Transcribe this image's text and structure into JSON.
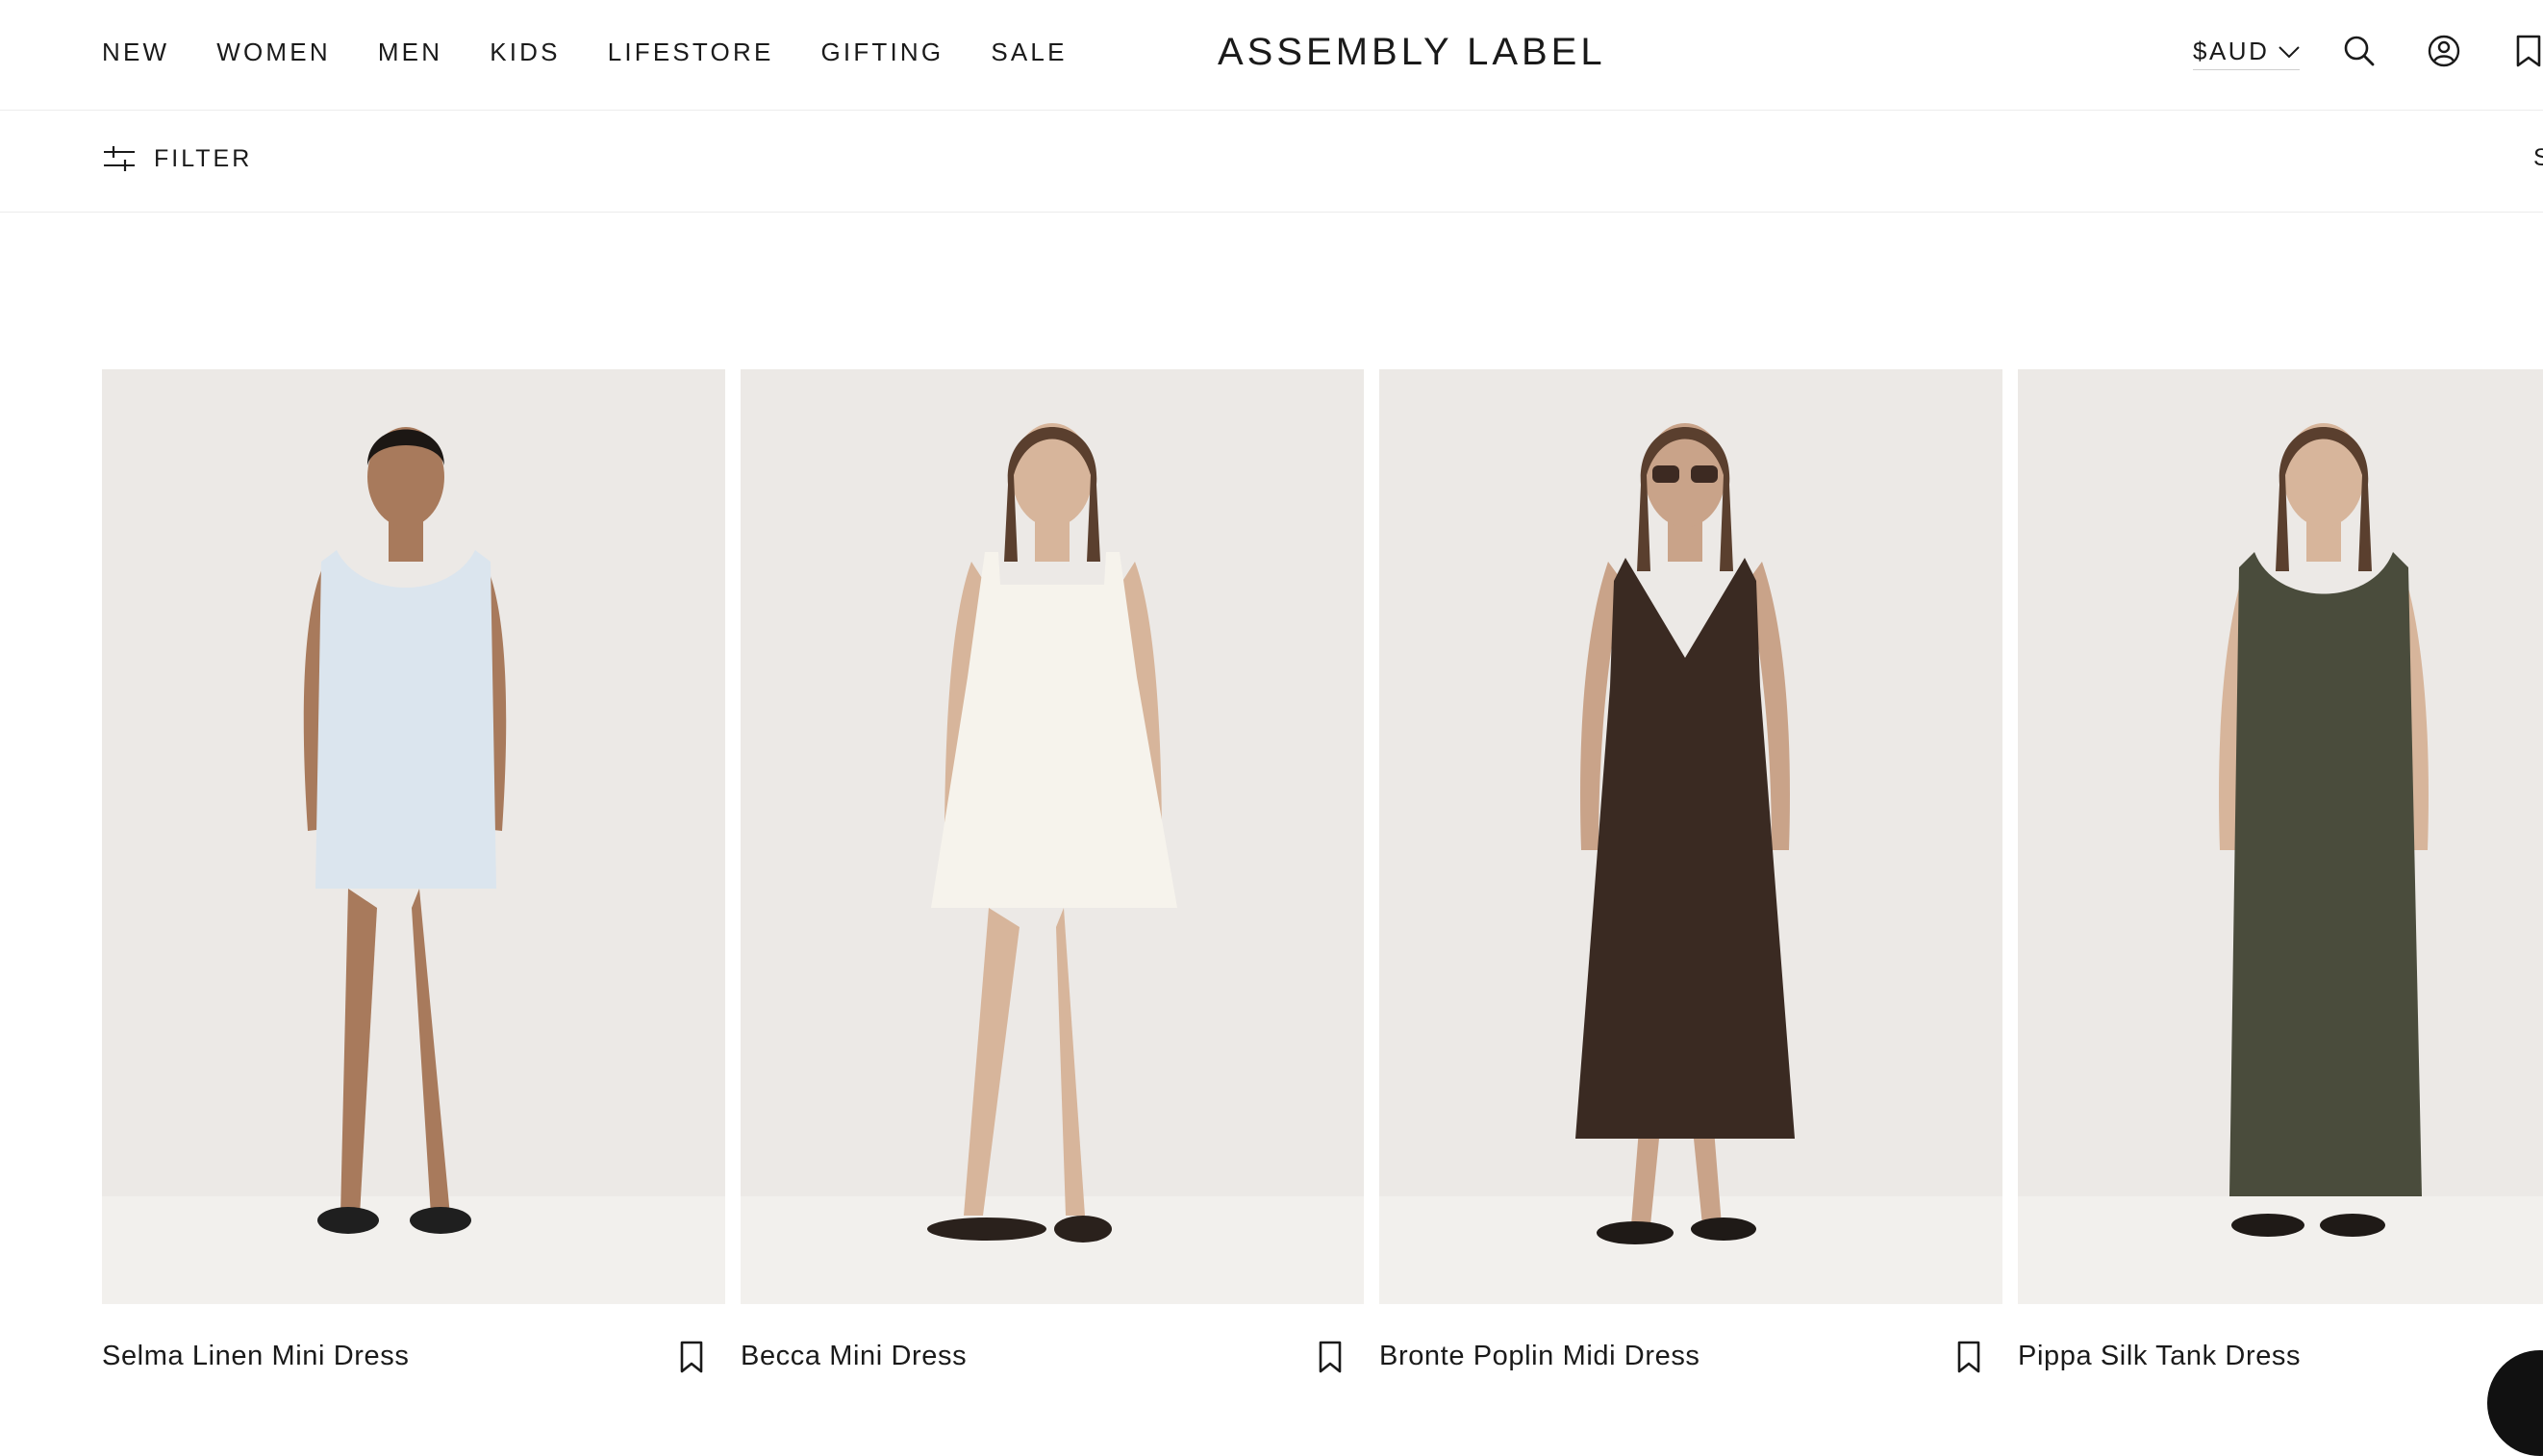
{
  "nav": {
    "items": [
      "NEW",
      "WOMEN",
      "MEN",
      "KIDS",
      "LIFESTORE",
      "GIFTING",
      "SALE"
    ]
  },
  "brand": {
    "logo_text": "ASSEMBLY LABEL"
  },
  "header_actions": {
    "currency": "$AUD",
    "icons": [
      "search-icon",
      "account-icon",
      "wishlist-icon"
    ]
  },
  "toolbar": {
    "filter_label": "FILTER",
    "sort_peek": "S"
  },
  "products": [
    {
      "name": "Selma Linen Mini Dress",
      "dress_color": "#dbe5ee",
      "dress_style": "tank-mini"
    },
    {
      "name": "Becca Mini Dress",
      "dress_color": "#f6f3ec",
      "dress_style": "square-mini"
    },
    {
      "name": "Bronte Poplin Midi Dress",
      "dress_color": "#3a2a22",
      "dress_style": "strappy-midi"
    },
    {
      "name": "Pippa Silk Tank Dress",
      "dress_color": "#4a4c3c",
      "dress_style": "tank-maxi"
    }
  ],
  "colors": {
    "text": "#1a1a1a",
    "divider": "#ececec",
    "photo_bg": "#ece9e6",
    "skin": "#d7b59b"
  }
}
